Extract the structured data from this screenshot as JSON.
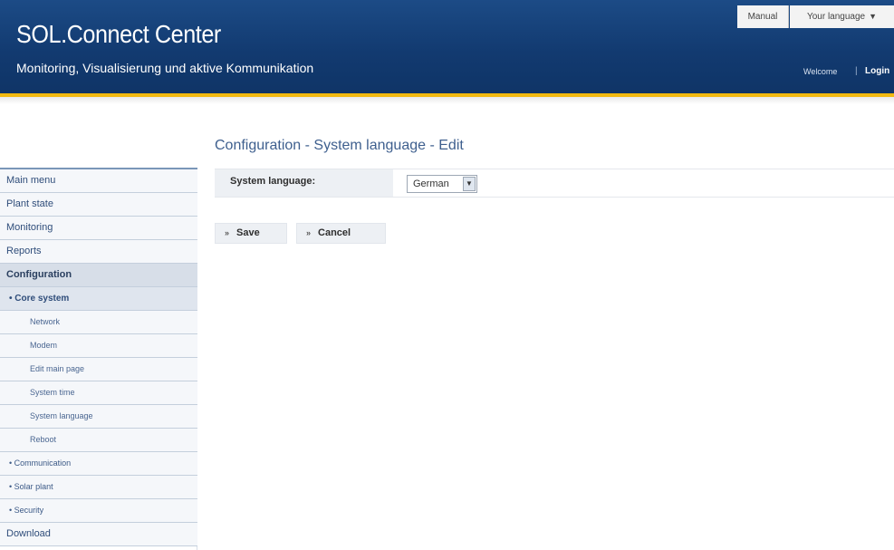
{
  "header": {
    "title": "SOL.Connect Center",
    "subtitle": "Monitoring, Visualisierung und aktive Kommunikation",
    "manual_label": "Manual",
    "language_label": "Your language",
    "welcome_text": "Welcome",
    "login_label": "Login"
  },
  "sidebar": {
    "items": [
      {
        "label": "Main menu"
      },
      {
        "label": "Plant state"
      },
      {
        "label": "Monitoring"
      },
      {
        "label": "Reports"
      },
      {
        "label": "Configuration"
      },
      {
        "label": "• Core system"
      },
      {
        "label": "Network"
      },
      {
        "label": "Modem"
      },
      {
        "label": "Edit main page"
      },
      {
        "label": "System time"
      },
      {
        "label": "System language"
      },
      {
        "label": "Reboot"
      },
      {
        "label": "• Communication"
      },
      {
        "label": "• Solar plant"
      },
      {
        "label": "• Security"
      },
      {
        "label": "Download"
      }
    ]
  },
  "main": {
    "page_title": "Configuration - System language - Edit",
    "field_label": "System language:",
    "selected_language": "German",
    "save_label": "Save",
    "cancel_label": "Cancel"
  },
  "colors": {
    "header_blue": "#123a70",
    "accent_gold": "#f2b90f",
    "link_blue": "#2f4d7a"
  }
}
